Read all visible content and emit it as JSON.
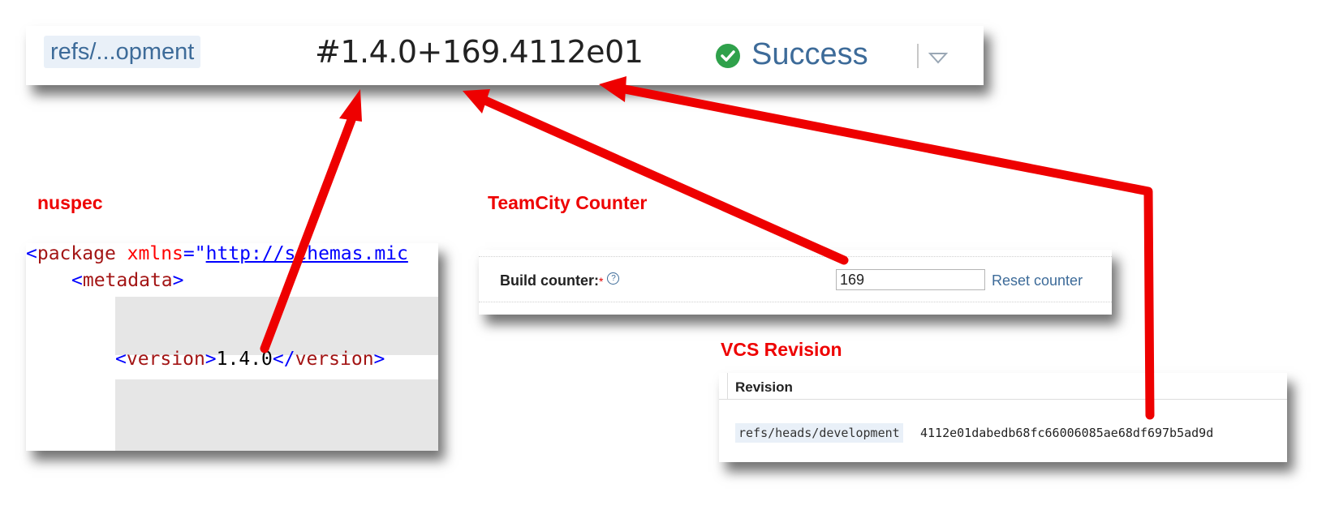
{
  "build_bar": {
    "branch": "refs/...opment",
    "build_number": "#1.4.0+169.4112e01",
    "status": "Success",
    "status_icon": "check-circle-icon",
    "dropdown_icon": "chevron-down-icon"
  },
  "labels": {
    "nuspec": "nuspec",
    "counter": "TeamCity Counter",
    "vcs": "VCS Revision"
  },
  "nuspec": {
    "line1_tag": "package",
    "line1_attr": "xmlns",
    "line1_url": "http://schemas.mic",
    "line2_tag": "metadata",
    "version_tag": "version",
    "version_value": "1.4.0"
  },
  "counter": {
    "label": "Build counter:",
    "required_mark": "*",
    "help_icon": "question-icon",
    "value": "169",
    "reset_label": "Reset counter"
  },
  "vcs": {
    "header": "Revision",
    "branch": "refs/heads/development",
    "hash": "4112e01dabedb68fc66006085ae68df697b5ad9d"
  },
  "colors": {
    "annotation_red": "#ee0000",
    "success_green": "#2fa14b",
    "link_blue": "#3d6b99"
  }
}
